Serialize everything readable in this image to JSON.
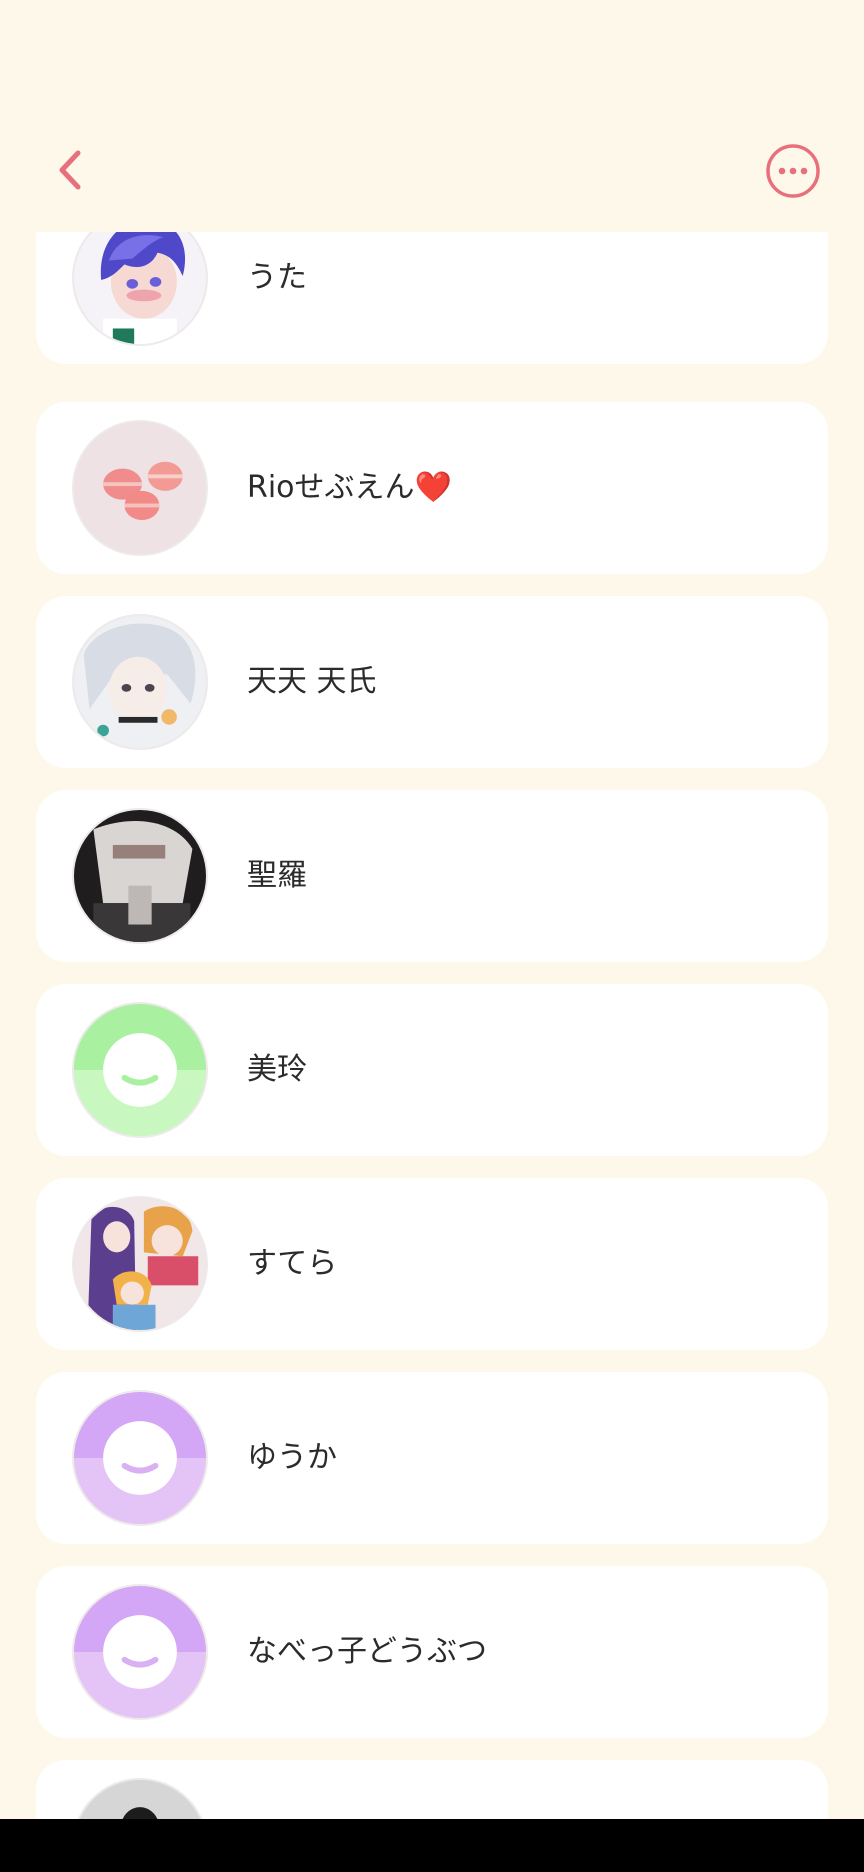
{
  "header": {
    "back_icon": "chevron-left-icon",
    "more_icon": "more-horizontal-circle-icon",
    "accent_color": "#e8707c"
  },
  "contacts": [
    {
      "name": "うた",
      "avatar": "anime-boy-photo"
    },
    {
      "name": "Rioせぶえん",
      "emoji": "❤️",
      "avatar": "macaron-photo"
    },
    {
      "name": "天天 天氏",
      "avatar": "anime-girl-photo"
    },
    {
      "name": "聖羅",
      "avatar": "hoodie-photo"
    },
    {
      "name": "美玲",
      "avatar": "default-face-green"
    },
    {
      "name": "すてら",
      "avatar": "anime-group-photo"
    },
    {
      "name": "ゆうか",
      "avatar": "default-face-purple"
    },
    {
      "name": "なべっ子どうぶつ",
      "avatar": "default-face-purple"
    },
    {
      "name": "",
      "avatar": "grey-photo"
    }
  ]
}
